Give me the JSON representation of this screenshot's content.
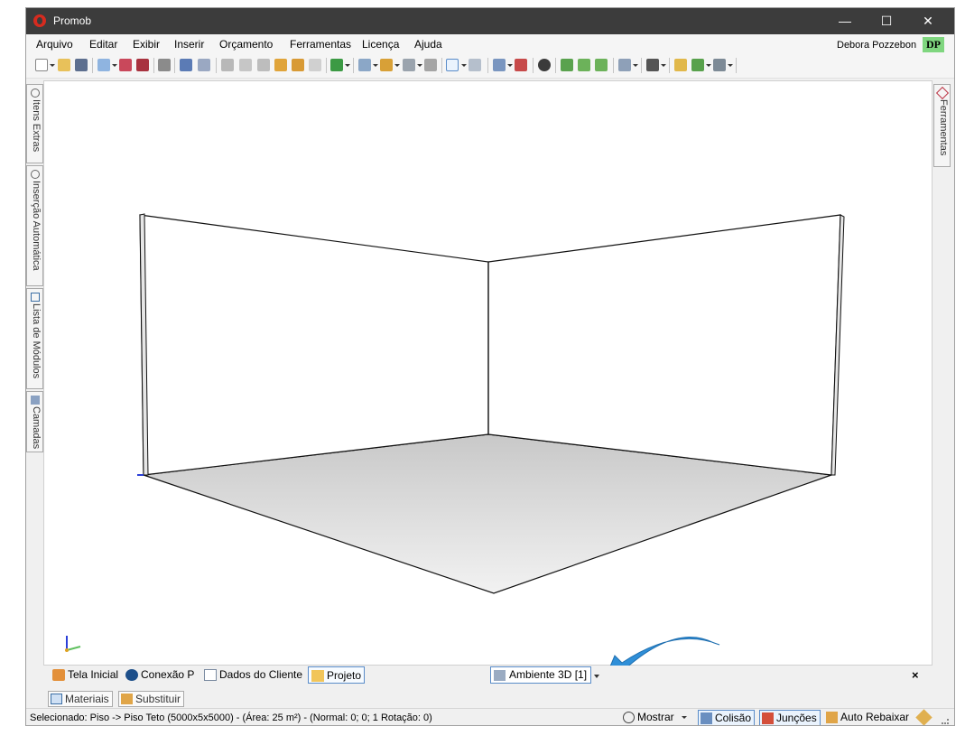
{
  "window": {
    "title": "Promob",
    "minimize_glyph": "—",
    "maximize_glyph": "☐",
    "close_glyph": "✕"
  },
  "menu": {
    "items": [
      "Arquivo",
      "Editar",
      "Exibir",
      "Inserir",
      "Orçamento",
      "Ferramentas",
      "Licença",
      "Ajuda"
    ]
  },
  "user": {
    "name": "Debora Pozzebon",
    "initials": "DP"
  },
  "left_tabs": [
    "Itens Extras",
    "Inserção Automática",
    "Lista de Módulos",
    "Camadas"
  ],
  "right_tabs": [
    "Ferramentas"
  ],
  "doc_tabs": {
    "items": [
      "Tela Inicial",
      "Conexão P",
      "Dados do Cliente",
      "Projeto"
    ],
    "active": "Projeto",
    "environment": "Ambiente 3D [1]",
    "close_glyph": "×"
  },
  "panel_tabs": [
    "Materiais",
    "Substituir"
  ],
  "status": {
    "text": "Selecionado: Piso -> Piso Teto (5000x5x5000) - (Área: 25 m²) - (Normal: 0; 0; 1 Rotação: 0)",
    "mostrar": "Mostrar",
    "colisao": "Colisão",
    "juncoes": "Junções",
    "auto_rebaixar": "Auto Rebaixar"
  },
  "colors": {
    "titlebar": "#3c3c3c",
    "accent": "#5a8cc9",
    "avatar": "#7fd67f",
    "annotation_arrow": "#2f8fd8"
  },
  "icons": {
    "app": "promob-logo-icon",
    "tools": "tools-icon",
    "annotation": "curved-arrow-icon"
  }
}
